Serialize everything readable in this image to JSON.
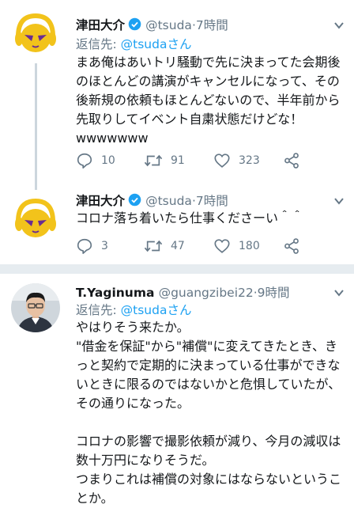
{
  "tweets": [
    {
      "name": "津田大介",
      "handle": "@tsuda",
      "dot": "·",
      "time": "7時間",
      "reply_label": "返信先: ",
      "reply_mention": "@tsudaさん",
      "text": "まあ俺はあいトリ騒動で先に決まってた会期後のほとんどの講演がキャンセルになって、その後新規の依頼もほとんどないので、半年前から先取りしてイベント自粛状態だけどな！wwwwwww",
      "replies": "10",
      "retweets": "91",
      "likes": "323",
      "avatar": "headphone-logo-avatar",
      "verified": true
    },
    {
      "name": "津田大介",
      "handle": "@tsuda",
      "dot": "·",
      "time": "7時間",
      "text": "コロナ落ち着いたら仕事くださーい＾＾",
      "replies": "3",
      "retweets": "47",
      "likes": "180",
      "avatar": "headphone-logo-avatar",
      "verified": true
    },
    {
      "name": "T.Yaginuma",
      "handle": "@guangzibei22",
      "dot": "·",
      "time": "9時間",
      "reply_label": "返信先: ",
      "reply_mention": "@tsudaさん",
      "text": "やはりそう来たか。\n\"借金を保証\"から\"補償\"に変えてきたとき、きっと契約で定期的に決まっている仕事ができないときに限るのではないかと危惧していたが、その通りになった。\n\nコロナの影響で撮影依頼が減り、今月の減収は数十万円になりそうだ。\nつまりこれは補償の対象にはならないということか。",
      "avatar": "person-photo-avatar"
    }
  ],
  "colors": {
    "accent": "#1da1f2",
    "secondary_text": "#657786",
    "separator": "#e1e8ed",
    "logo_yellow": "#f2c31b",
    "logo_purple": "#6a2c91"
  }
}
